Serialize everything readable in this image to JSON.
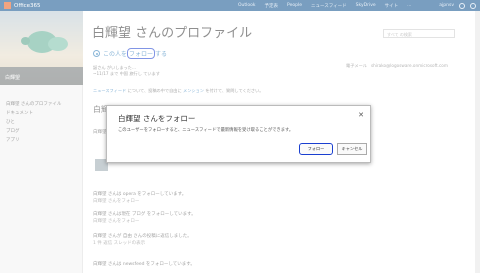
{
  "suitebar": {
    "app_name": "Office365",
    "nav": [
      "Outlook",
      "予定表",
      "People",
      "ニュースフィード",
      "SkyDrive",
      "サイト",
      "..."
    ],
    "user": "ajpnsv",
    "brand_color": "#0b4f8c"
  },
  "left": {
    "profile_name": "白輝望",
    "nav_items": [
      "白輝望 さんのプロファイル",
      "ドキュメント",
      "ひと",
      "ブログ",
      "アプリ"
    ]
  },
  "main": {
    "title": "白輝望 さんのプロファイル",
    "follow_text": "この人を",
    "follow_highlight": "フォロー",
    "follow_suffix": "する",
    "info_line1": "誕さん がいしまった…",
    "info_line2": "~11/17 まで 中国 旅行し ています",
    "info_line3_prefix": "ニュースフィード",
    "info_line3_mid": "について、投稿の中で自由に",
    "info_line3_link": "メンション",
    "info_line3_suffix": "を付けて、質問してください。",
    "email_label": "電子メール",
    "email_value": "shirako@logosware.onmicrosoft.com",
    "search_placeholder": "すべて の検索",
    "section_heading": "白輝望",
    "feed": [
      {
        "line": "白輝望 さんは opera をフォローしています。",
        "sub": "白輝望 さんをフォロー"
      },
      {
        "line": "白輝望 さんは現在 ブログ をフォローしています。",
        "sub": "白輝望 さんをフォロー"
      },
      {
        "line": "白輝望 さんが 自由 さんの投稿に返信しました。",
        "sub": "1 件 返信   スレッドの表示"
      },
      {
        "line": "白輝望 さんは newsfeed をフォローしています。",
        "sub": ""
      }
    ]
  },
  "dialog": {
    "title": "白輝望 さんをフォロー",
    "close_glyph": "✕",
    "message": "このユーザーをフォローすると、ニュースフィードで最新情報を受け取ることができます。",
    "follow_button": "フォロー",
    "cancel_button": "キャンセル"
  }
}
